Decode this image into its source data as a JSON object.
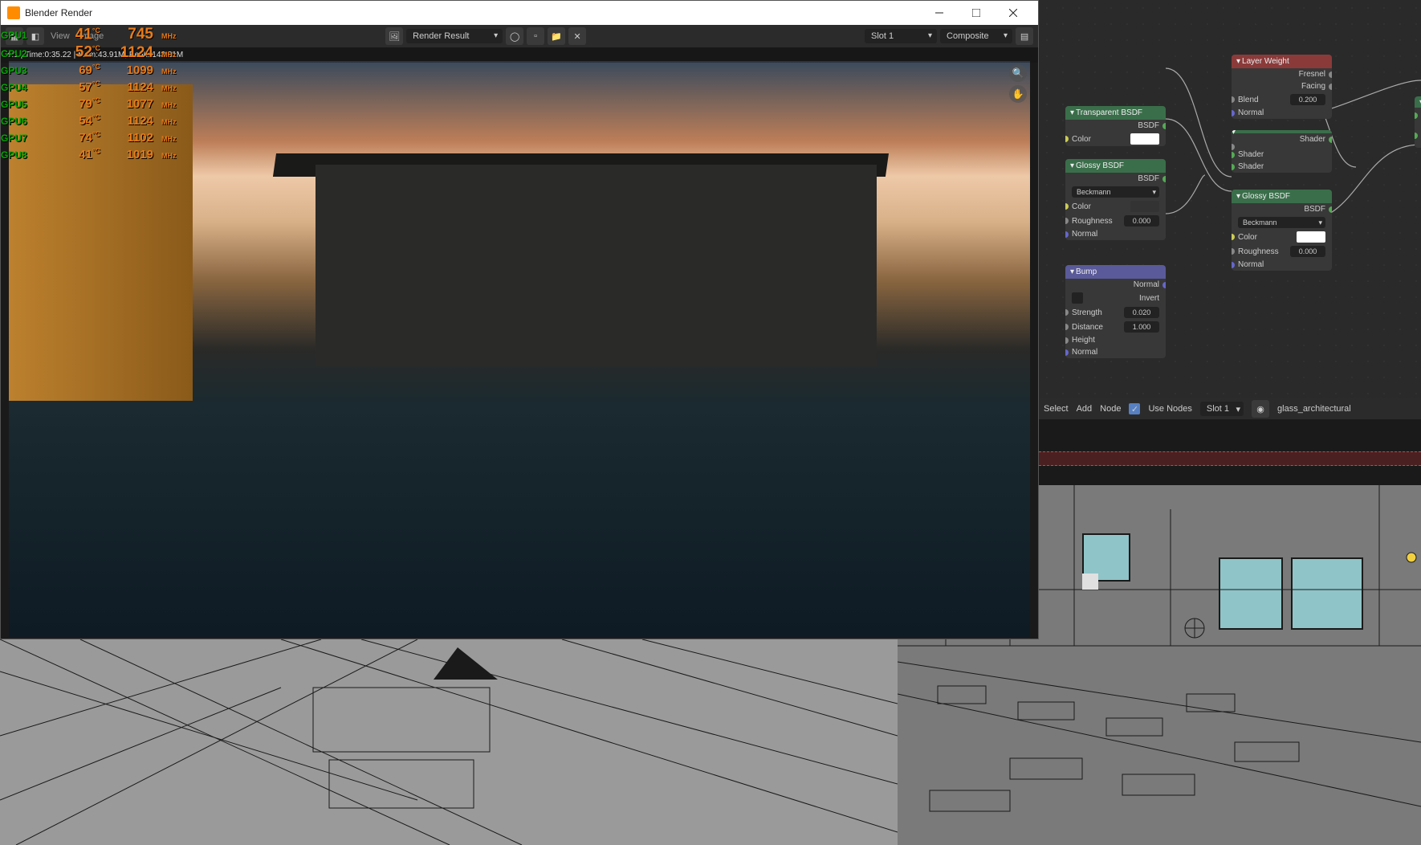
{
  "window": {
    "title": "Blender Render"
  },
  "toolbar": {
    "view_label": "View",
    "image_label": "Image",
    "render_result": "Render Result",
    "slot": "Slot 1",
    "composite": "Composite"
  },
  "status": "e:1 | Time:0:35.22 | Mem:43.91M, Peak: 143.91M",
  "gpu_overlay": [
    {
      "name": "GPU1",
      "temp": "41",
      "clock": "745",
      "big": true
    },
    {
      "name": "GPU2",
      "temp": "52",
      "clock": "1124",
      "big": true
    },
    {
      "name": "GPU3",
      "temp": "69",
      "clock": "1099"
    },
    {
      "name": "GPU4",
      "temp": "57",
      "clock": "1124"
    },
    {
      "name": "GPU5",
      "temp": "79",
      "clock": "1077"
    },
    {
      "name": "GPU6",
      "temp": "54",
      "clock": "1124"
    },
    {
      "name": "GPU7",
      "temp": "74",
      "clock": "1102"
    },
    {
      "name": "GPU8",
      "temp": "41",
      "clock": "1019"
    }
  ],
  "units": {
    "deg": "°C",
    "mhz": "MHz"
  },
  "nodes": {
    "layer_weight": {
      "title": "Layer Weight",
      "out1": "Fresnel",
      "out2": "Facing",
      "blend_label": "Blend",
      "blend_val": "0.200",
      "normal": "Normal"
    },
    "transparent": {
      "title": "Transparent BSDF",
      "bsdf": "BSDF",
      "color": "Color",
      "swatch": "#ffffff"
    },
    "glossy1": {
      "title": "Glossy BSDF",
      "bsdf": "BSDF",
      "dist": "Beckmann",
      "color": "Color",
      "swatch": "#333333",
      "rough_label": "Roughness",
      "rough_val": "0.000",
      "normal": "Normal"
    },
    "bump": {
      "title": "Bump",
      "normal_out": "Normal",
      "invert": "Invert",
      "strength_label": "Strength",
      "strength_val": "0.020",
      "distance_label": "Distance",
      "distance_val": "1.000",
      "height": "Height",
      "normal_in": "Normal"
    },
    "mix": {
      "shader1": "Shader",
      "shader2": "Shader",
      "shader_out": "Shader"
    },
    "glossy2": {
      "title": "Glossy BSDF",
      "bsdf": "BSDF",
      "dist": "Beckmann",
      "color": "Color",
      "swatch": "#ffffff",
      "rough_label": "Roughness",
      "rough_val": "0.000",
      "normal": "Normal"
    }
  },
  "node_bar": {
    "select": "Select",
    "add": "Add",
    "node": "Node",
    "use_nodes": "Use Nodes",
    "slot": "Slot 1",
    "material": "glass_architectural"
  }
}
